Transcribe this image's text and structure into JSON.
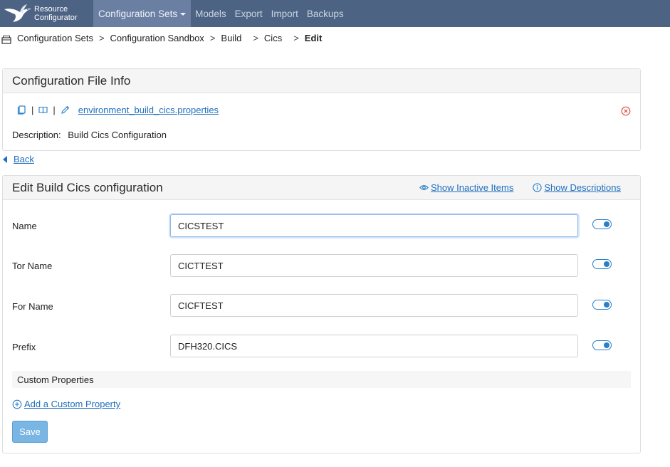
{
  "app": {
    "brand_line1": "Resource",
    "brand_line2": "Configurator"
  },
  "nav": {
    "items": [
      {
        "label": "Configuration Sets"
      },
      {
        "label": "Models"
      },
      {
        "label": "Export"
      },
      {
        "label": "Import"
      },
      {
        "label": "Backups"
      }
    ]
  },
  "breadcrumb": {
    "items": [
      "Configuration Sets",
      "Configuration Sandbox",
      "Build",
      "Cics"
    ],
    "separator": ">",
    "current": "Edit"
  },
  "file_info": {
    "title": "Configuration File Info",
    "pipe": "|",
    "filename": "environment_build_cics.properties",
    "description_label": "Description:",
    "description_value": "Build Cics Configuration"
  },
  "back": {
    "label": "Back"
  },
  "edit": {
    "title": "Edit Build Cics configuration",
    "show_inactive": "Show Inactive Items",
    "show_descriptions": "Show Descriptions",
    "fields": [
      {
        "label": "Name",
        "value": "CICSTEST"
      },
      {
        "label": "Tor Name",
        "value": "CICTTEST"
      },
      {
        "label": "For Name",
        "value": "CICFTEST"
      },
      {
        "label": "Prefix",
        "value": "DFH320.CICS"
      }
    ],
    "custom_properties": "Custom Properties",
    "add_custom": "Add a Custom Property",
    "save": "Save"
  },
  "colors": {
    "nav_bg": "#4d6384",
    "link": "#1f6fbf",
    "save_bg": "#79b6e3",
    "delete": "#d9534f"
  }
}
